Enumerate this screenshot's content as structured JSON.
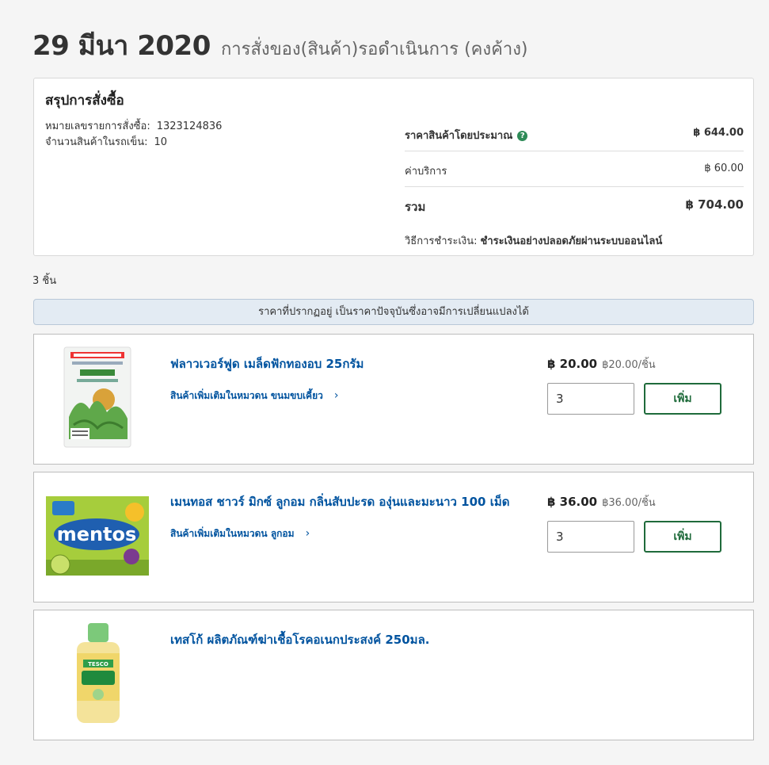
{
  "header": {
    "date": "29 มีนา 2020",
    "status": "การสั่งของ(สินค้า)รอดำเนินการ (คงค้าง)"
  },
  "summary": {
    "title": "สรุปการสั่งซื้อ",
    "order_number_label": "หมายเลขรายการสั่งซื้อ:",
    "order_number": "1323124836",
    "items_in_cart_label": "จำนวนสินค้าในรถเข็น:",
    "items_in_cart": "10",
    "estimated_price_label": "ราคาสินค้าโดยประมาณ",
    "estimated_price": "฿ 644.00",
    "service_fee_label": "ค่าบริการ",
    "service_fee": "฿ 60.00",
    "total_label": "รวม",
    "total": "฿ 704.00",
    "payment_label": "วิธีการชำระเงิน:",
    "payment_value": "ชำระเงินอย่างปลอดภัยผ่านระบบออนไลน์"
  },
  "item_count": "3 ชิ้น",
  "notice": "ราคาที่ปรากฏอยู่ เป็นราคาปัจจุบันซึ่งอาจมีการเปลี่ยนแปลงได้",
  "products": [
    {
      "name": "ฟลาวเวอร์ฟูด เมล็ดฟักทองอบ 25กรัม",
      "category_link": "สินค้าเพิ่มเติมในหมวดน ขนมขบเคี้ยว",
      "price": "฿ 20.00",
      "unit_price": "฿20.00/ชิ้น",
      "quantity": "3",
      "add_label": "เพิ่ม",
      "image_icon": "pumpkin-seeds-package-image"
    },
    {
      "name": "เมนทอส ชาวร์ มิกซ์ ลูกอม กลิ่นสับปะรด องุ่นและมะนาว 100 เม็ด",
      "category_link": "สินค้าเพิ่มเติมในหมวดน ลูกอม",
      "price": "฿ 36.00",
      "unit_price": "฿36.00/ชิ้น",
      "quantity": "3",
      "add_label": "เพิ่ม",
      "image_icon": "mentos-candy-bag-image",
      "image_text": "mentos"
    },
    {
      "name": "เทสโก้ ผลิตภัณฑ์ฆ่าเชื้อโรคอเนกประสงค์ 250มล.",
      "image_icon": "disinfectant-bottle-image",
      "image_text": "TESCO"
    }
  ],
  "chevron_glyph": "›",
  "help_glyph": "?"
}
